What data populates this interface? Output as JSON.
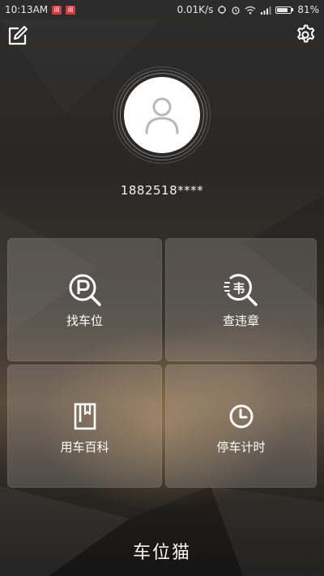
{
  "status_bar": {
    "time": "10:13AM",
    "notif_1": "阅",
    "notif_2": "阅",
    "net_speed": "0.01K/s",
    "battery_percent": "81%",
    "battery_level": 0.81
  },
  "header": {
    "edit_icon": "edit-icon",
    "settings_icon": "gear-icon"
  },
  "profile": {
    "phone": "1882518****",
    "avatar_icon": "user-icon"
  },
  "menu": {
    "find_parking": {
      "label": "找车位",
      "icon": "parking-search-icon"
    },
    "check_violations": {
      "label": "查违章",
      "icon": "violation-search-icon"
    },
    "car_wiki": {
      "label": "用车百科",
      "icon": "book-icon"
    },
    "parking_timer": {
      "label": "停车计时",
      "icon": "clock-icon"
    }
  },
  "app_title": "车位猫",
  "colors": {
    "tile_bg": "rgba(255,255,255,0.17)",
    "notif_red": "#d9363e",
    "text": "#ffffff"
  }
}
